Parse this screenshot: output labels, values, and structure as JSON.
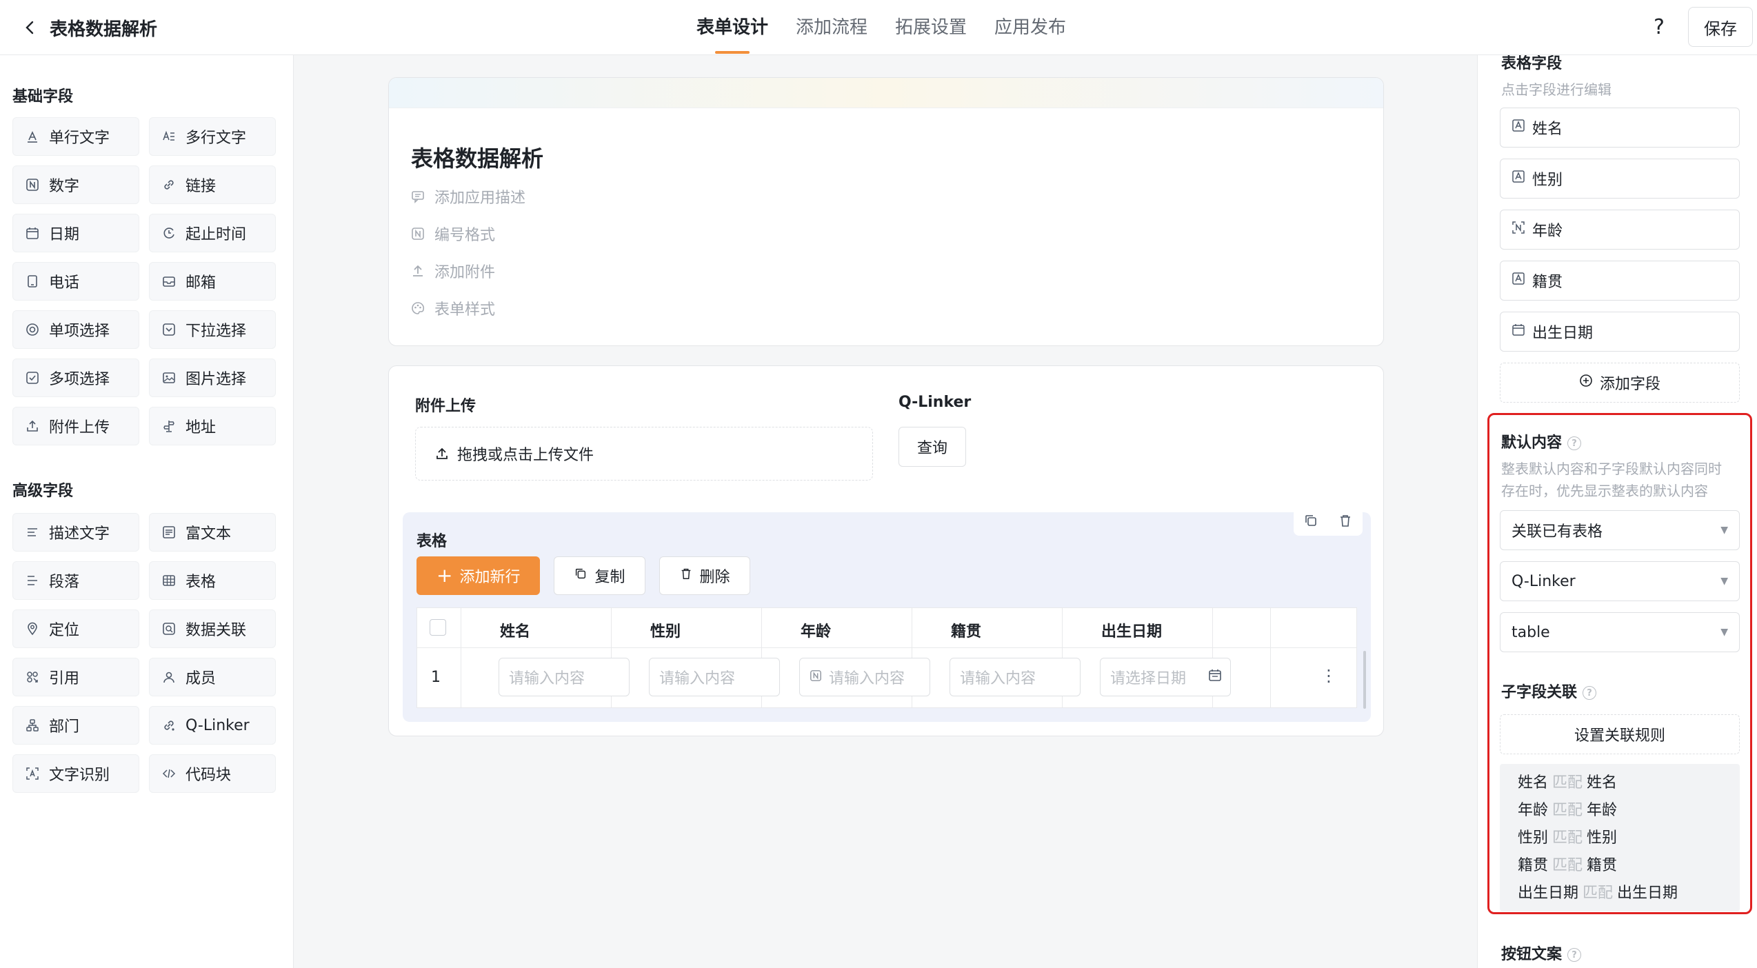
{
  "header": {
    "back_icon": "chevron-left-icon",
    "title": "表格数据解析",
    "tabs": [
      "表单设计",
      "添加流程",
      "拓展设置",
      "应用发布"
    ],
    "active_tab": 0,
    "help_label": "?",
    "save_label": "保存",
    "accent_color": "#f28f3b"
  },
  "palette": {
    "basic_title": "基础字段",
    "basic_fields": [
      {
        "label": "单行文字",
        "icon": "single-text-icon"
      },
      {
        "label": "多行文字",
        "icon": "multi-text-icon"
      },
      {
        "label": "数字",
        "icon": "number-icon"
      },
      {
        "label": "链接",
        "icon": "link-icon"
      },
      {
        "label": "日期",
        "icon": "calendar-icon"
      },
      {
        "label": "起止时间",
        "icon": "time-range-icon"
      },
      {
        "label": "电话",
        "icon": "phone-icon"
      },
      {
        "label": "邮箱",
        "icon": "mail-icon"
      },
      {
        "label": "单项选择",
        "icon": "radio-icon"
      },
      {
        "label": "下拉选择",
        "icon": "dropdown-icon"
      },
      {
        "label": "多项选择",
        "icon": "checkbox-icon"
      },
      {
        "label": "图片选择",
        "icon": "image-icon"
      },
      {
        "label": "附件上传",
        "icon": "upload-icon"
      },
      {
        "label": "地址",
        "icon": "address-icon"
      }
    ],
    "advanced_title": "高级字段",
    "advanced_fields": [
      {
        "label": "描述文字",
        "icon": "description-icon"
      },
      {
        "label": "富文本",
        "icon": "rich-text-icon"
      },
      {
        "label": "段落",
        "icon": "paragraph-icon"
      },
      {
        "label": "表格",
        "icon": "table-icon"
      },
      {
        "label": "定位",
        "icon": "location-icon"
      },
      {
        "label": "数据关联",
        "icon": "data-link-icon"
      },
      {
        "label": "引用",
        "icon": "reference-icon"
      },
      {
        "label": "成员",
        "icon": "member-icon"
      },
      {
        "label": "部门",
        "icon": "department-icon"
      },
      {
        "label": "Q-Linker",
        "icon": "q-linker-icon"
      },
      {
        "label": "文字识别",
        "icon": "ocr-icon"
      },
      {
        "label": "代码块",
        "icon": "code-icon"
      }
    ]
  },
  "form": {
    "title": "表格数据解析",
    "meta": [
      {
        "label": "添加应用描述",
        "icon": "comment-icon"
      },
      {
        "label": "编号格式",
        "icon": "number-icon"
      },
      {
        "label": "添加附件",
        "icon": "upload-icon"
      },
      {
        "label": "表单样式",
        "icon": "palette-icon"
      }
    ],
    "upload_label": "附件上传",
    "upload_hint": "拖拽或点击上传文件",
    "qlinker_label": "Q-Linker",
    "query_label": "查询",
    "table": {
      "title": "表格",
      "add_row": "添加新行",
      "copy": "复制",
      "delete": "删除",
      "columns": [
        "姓名",
        "性别",
        "年龄",
        "籍贯",
        "出生日期"
      ],
      "row_index": "1",
      "placeholders": [
        "请输入内容",
        "请输入内容",
        "请输入内容",
        "请输入内容",
        "请选择日期"
      ],
      "more_label": "⋮"
    }
  },
  "right_panel": {
    "fields_title": "表格字段",
    "fields_subtitle": "点击字段进行编辑",
    "fields": [
      "姓名",
      "性别",
      "年龄",
      "籍贯",
      "出生日期"
    ],
    "add_field": "添加字段",
    "default_title": "默认内容",
    "default_desc_1": "整表默认内容和子字段默认内容同时",
    "default_desc_2": "存在时，优先显示整表的默认内容",
    "selects": [
      "关联已有表格",
      "Q-Linker",
      "table"
    ],
    "sub_title": "子字段关联",
    "rule_button": "设置关联规则",
    "match_word": "匹配",
    "mappings": [
      [
        "姓名",
        "姓名"
      ],
      [
        "年龄",
        "年龄"
      ],
      [
        "性别",
        "性别"
      ],
      [
        "籍贯",
        "籍贯"
      ],
      [
        "出生日期",
        "出生日期"
      ]
    ],
    "button_text_title": "按钮文案",
    "highlight_color": "#e02020"
  }
}
